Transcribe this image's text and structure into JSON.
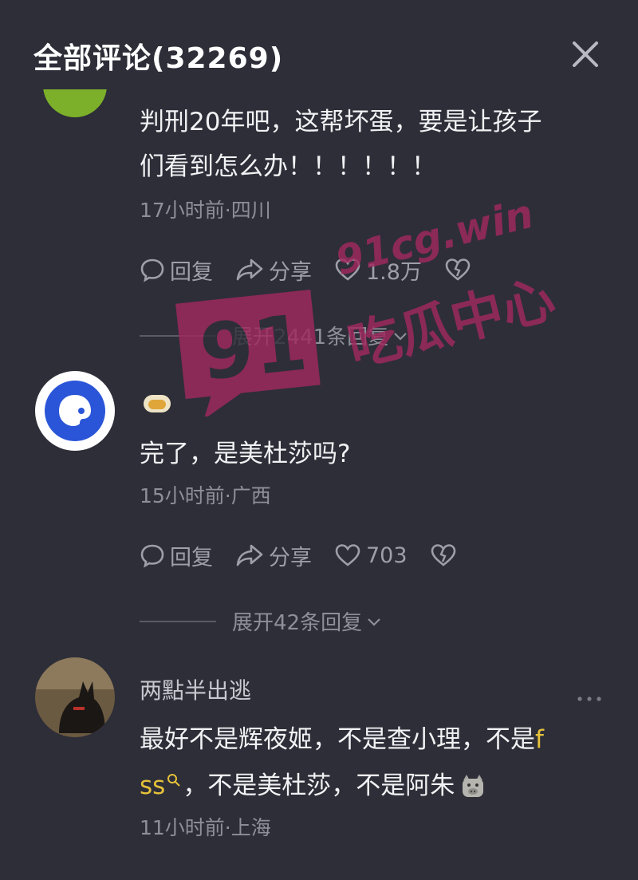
{
  "header": {
    "title": "全部评论(32269)",
    "close_icon": "close-icon"
  },
  "comments": [
    {
      "text_line1": "判刑20年吧，这帮坏蛋，要是让孩子",
      "text_line2": "们看到怎么办！！！！！！",
      "meta": "17小时前·四川",
      "reply_label": "回复",
      "share_label": "分享",
      "like_count": "1.8万",
      "expand_label": "展开2441条回复"
    },
    {
      "text": "完了，是美杜莎吗?",
      "meta": "15小时前·广西",
      "reply_label": "回复",
      "share_label": "分享",
      "like_count": "703",
      "expand_label": "展开42条回复"
    },
    {
      "username": "两點半出逃",
      "text_line1_a": "最好不是辉夜姬，不是查小理，不是",
      "text_line1_b": "f",
      "text_line2_a": "ss",
      "text_line2_b": "，不是美杜莎，不是阿朱",
      "meta": "11小时前·上海"
    }
  ],
  "watermark": {
    "badge_number": "91",
    "domain": "91cg.win",
    "label": "吃瓜中心"
  },
  "colors": {
    "background": "#2d2e38",
    "text": "#f2f2f4",
    "muted": "#8e8f99",
    "watermark": "#a0285f",
    "highlight": "#e6c13a"
  }
}
